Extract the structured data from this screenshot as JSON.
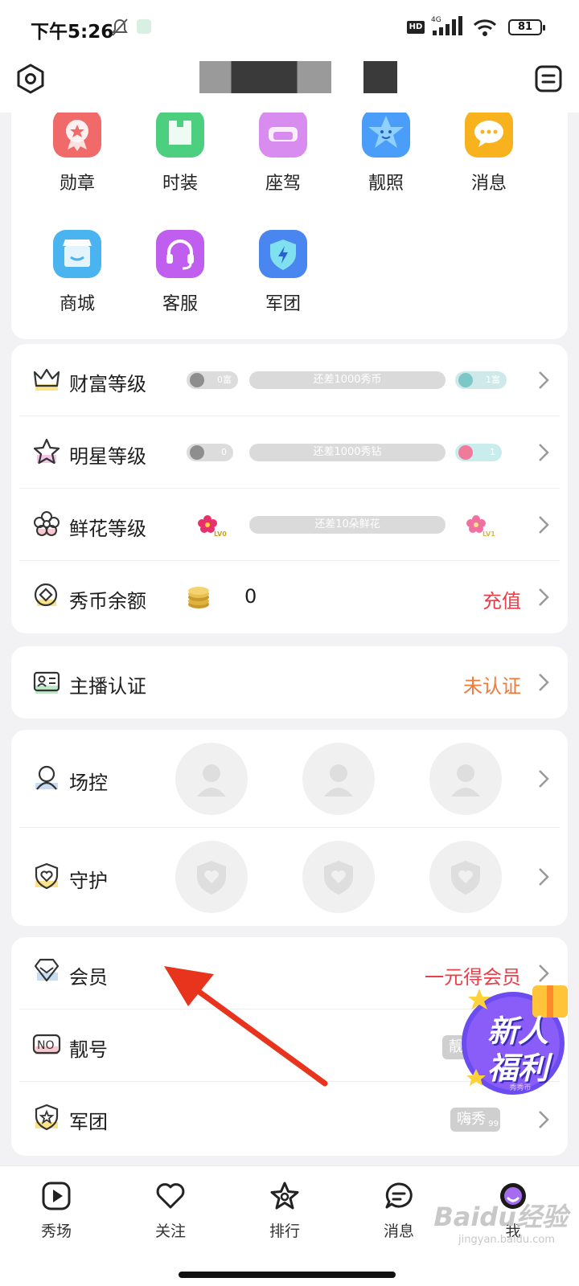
{
  "status_bar": {
    "time": "下午5:26",
    "network": "4G",
    "battery": "81"
  },
  "grid": [
    {
      "label": "勋章",
      "icon": "medal-icon",
      "color": "#f06a6a"
    },
    {
      "label": "时装",
      "icon": "fashion-icon",
      "color": "#4ccf7f"
    },
    {
      "label": "座驾",
      "icon": "car-icon",
      "color": "#d98cf0"
    },
    {
      "label": "靓照",
      "icon": "photo-icon",
      "color": "#4a9df8"
    },
    {
      "label": "消息",
      "icon": "message-icon",
      "color": "#f8b21e"
    },
    {
      "label": "商城",
      "icon": "shop-icon",
      "color": "#4ab4f0"
    },
    {
      "label": "客服",
      "icon": "support-icon",
      "color": "#c05ef0"
    },
    {
      "label": "军团",
      "icon": "legion-icon",
      "color": "#4a86f0"
    }
  ],
  "levels": {
    "wealth": {
      "label": "财富等级",
      "from": "0富",
      "progress_text": "还差1000秀币",
      "to": "1富",
      "progress": 0
    },
    "star": {
      "label": "明星等级",
      "from": "0",
      "progress_text": "还差1000秀钻",
      "to": "1",
      "progress": 0
    },
    "flower": {
      "label": "鲜花等级",
      "from": "LV0",
      "progress_text": "还差10朵鲜花",
      "to": "LV1",
      "progress": 0
    },
    "balance": {
      "label": "秀币余额",
      "value": "0",
      "action": "充值"
    }
  },
  "anchor": {
    "label": "主播认证",
    "status": "未认证"
  },
  "control": {
    "label": "场控"
  },
  "guard": {
    "label": "守护"
  },
  "vip": {
    "label": "会员",
    "action": "一元得会员"
  },
  "pretty_number": {
    "label": "靓号",
    "tag": "靓"
  },
  "legion": {
    "label": "军团",
    "tag": "嗨秀",
    "tag_sub": "99"
  },
  "promo": {
    "line1": "新人",
    "line2": "福利",
    "sub": "秀秀币"
  },
  "nav": [
    {
      "label": "秀场",
      "icon": "play-icon"
    },
    {
      "label": "关注",
      "icon": "heart-icon"
    },
    {
      "label": "排行",
      "icon": "star-rank-icon"
    },
    {
      "label": "消息",
      "icon": "chat-icon"
    },
    {
      "label": "我",
      "icon": "profile-icon"
    }
  ],
  "watermark": {
    "text": "Baidu经验",
    "sub": "jingyan.baidu.com"
  },
  "colors": {
    "accent_red": "#e8404a",
    "accent_orange": "#ee7a3c",
    "arrow": "#e8341c"
  }
}
